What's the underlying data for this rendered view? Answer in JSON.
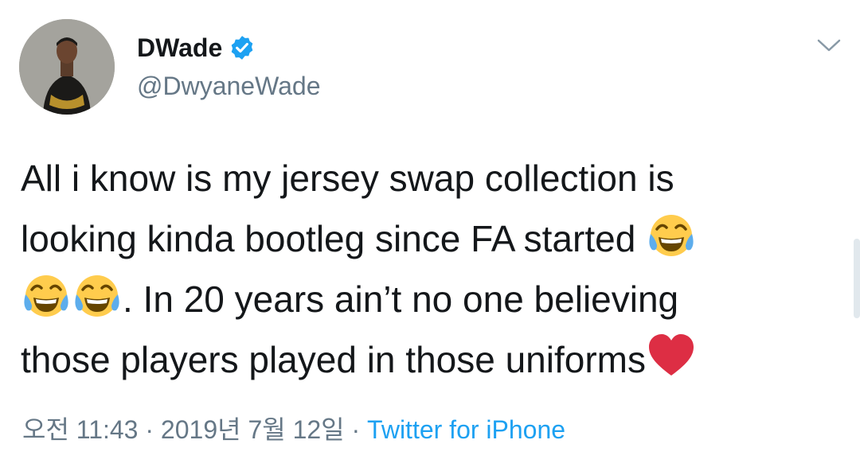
{
  "user": {
    "display_name": "DWade",
    "handle": "@DwyaneWade",
    "verified": true,
    "verified_color": "#1da1f2"
  },
  "tweet": {
    "segments": [
      {
        "type": "text",
        "value": "All i know is my jersey swap collection is\nlooking kinda bootleg since FA started "
      },
      {
        "type": "emoji",
        "icon": "face-with-tears-of-joy-icon"
      },
      {
        "type": "text",
        "value": "\n"
      },
      {
        "type": "emoji",
        "icon": "face-with-tears-of-joy-icon"
      },
      {
        "type": "emoji",
        "icon": "face-with-tears-of-joy-icon"
      },
      {
        "type": "text",
        "value": ". In 20 years ain’t no one believing\nthose players played in those uniforms"
      },
      {
        "type": "emoji",
        "icon": "red-heart-icon"
      }
    ]
  },
  "meta": {
    "time": "오전 11:43",
    "separator": " · ",
    "date": "2019년 7월 12일",
    "source": "Twitter for iPhone"
  },
  "icons": {
    "menu": "chevron-down-icon"
  },
  "colors": {
    "text": "#14171a",
    "secondary": "#657786",
    "link": "#1da1f2",
    "heart": "#e0245e"
  }
}
